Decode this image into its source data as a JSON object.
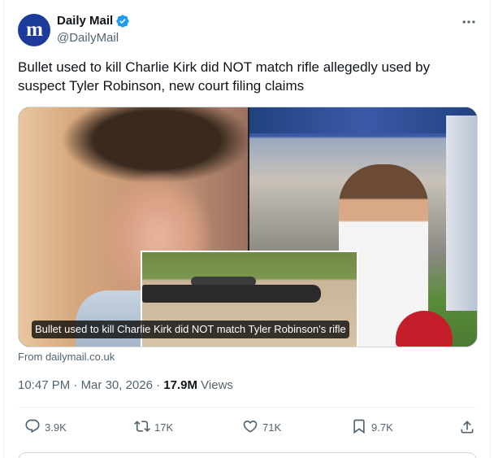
{
  "account": {
    "display_name": "Daily Mail",
    "handle": "@DailyMail",
    "avatar_letters": "m",
    "brand_color": "#1d3b9a",
    "verified_color": "#1d9bf0"
  },
  "tweet": {
    "text": "Bullet used to kill Charlie Kirk did NOT match rifle allegedly used by suspect Tyler Robinson, new court filing claims"
  },
  "media": {
    "caption": "Bullet used to kill Charlie Kirk did NOT match Tyler Robinson's rifle",
    "source": "From dailymail.co.uk"
  },
  "meta": {
    "time": "10:47 PM",
    "separator": "·",
    "date": "Mar 30, 2026",
    "views_count": "17.9M",
    "views_label": "Views"
  },
  "actions": {
    "replies": "3.9K",
    "reposts": "17K",
    "likes": "71K",
    "bookmarks": "9.7K"
  },
  "icons": {
    "more": "more-horizontal-icon",
    "reply": "reply-icon",
    "repost": "repost-icon",
    "like": "heart-icon",
    "bookmark": "bookmark-icon",
    "share": "share-icon"
  }
}
